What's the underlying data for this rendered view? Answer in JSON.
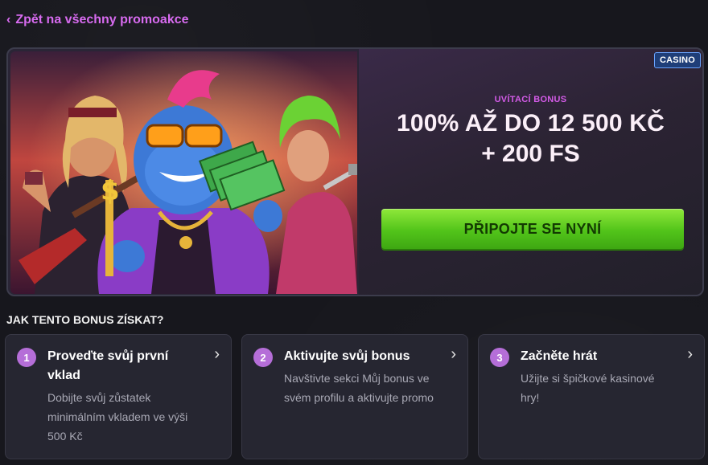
{
  "back_link": {
    "label": "Zpět na všechny promoakce"
  },
  "promo": {
    "badge": "CASINO",
    "label": "UVÍTACÍ BONUS",
    "title": "100% AŽ DO 12 500 KČ",
    "subtitle": "+ 200 FS",
    "cta": "PŘIPOJTE SE NYNÍ",
    "colors": {
      "cta": "#52c41a",
      "label": "#d45be8",
      "badge": "#1f3e78"
    }
  },
  "how": {
    "heading": "JAK TENTO BONUS ZÍSKAT?",
    "steps": [
      {
        "number": "1",
        "title": "Proveďte svůj první vklad",
        "description": "Dobijte svůj zůstatek minimálním vkladem ve výši 500 Kč"
      },
      {
        "number": "2",
        "title": "Aktivujte svůj bonus",
        "description": "Navštivte sekci Můj bonus ve svém profilu a aktivujte promo"
      },
      {
        "number": "3",
        "title": "Začněte hrát",
        "description": "Užijte si špičkové kasinové hry!"
      }
    ]
  }
}
